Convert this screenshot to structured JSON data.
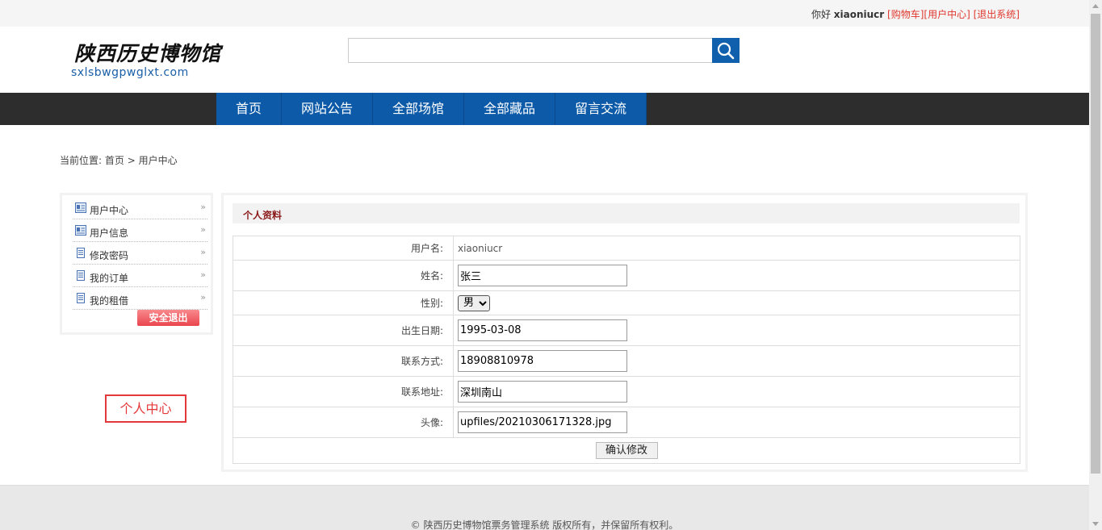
{
  "topbar": {
    "greeting": "你好",
    "username": "xiaoniucr",
    "cart_link": "[购物车]",
    "user_center_link": "[用户中心]",
    "logout_link": "[退出系统]"
  },
  "logo": {
    "chinese": "陕西历史博物馆",
    "domain": "sxlsbwgpwglxt.com"
  },
  "search": {
    "placeholder": "",
    "button_icon": "search-icon"
  },
  "nav": {
    "items": [
      "首页",
      "网站公告",
      "全部场馆",
      "全部藏品",
      "留言交流"
    ]
  },
  "breadcrumb": {
    "prefix": "当前位置:",
    "home": "首页",
    "separator": ">",
    "current": "用户中心"
  },
  "sidebar": {
    "items": [
      {
        "label": "用户中心",
        "icon": "id-card-icon"
      },
      {
        "label": "用户信息",
        "icon": "id-card-icon"
      },
      {
        "label": "修改密码",
        "icon": "document-icon"
      },
      {
        "label": "我的订单",
        "icon": "document-icon"
      },
      {
        "label": "我的租借",
        "icon": "document-icon"
      }
    ],
    "logout_button": "安全退出"
  },
  "badge": "个人中心",
  "panel": {
    "title": "个人资料",
    "fields": {
      "username_label": "用户名:",
      "username_value": "xiaoniucr",
      "name_label": "姓名:",
      "name_value": "张三",
      "gender_label": "性别:",
      "gender_value": "男",
      "birthday_label": "出生日期:",
      "birthday_value": "1995-03-08",
      "phone_label": "联系方式:",
      "phone_value": "18908810978",
      "address_label": "联系地址:",
      "address_value": "深圳南山",
      "avatar_label": "头像:",
      "avatar_value": "upfiles/20210306171328.jpg"
    },
    "submit_label": "确认修改"
  },
  "footer": {
    "copyright": "© 陕西历史博物馆票务管理系统 版权所有，并保留所有权利。"
  },
  "colors": {
    "nav_blue": "#0d5ba8",
    "nav_bar": "#2d2d2d",
    "link_red": "#e0382e",
    "badge_red": "#e5383a",
    "title_red": "#8b1a1a"
  }
}
